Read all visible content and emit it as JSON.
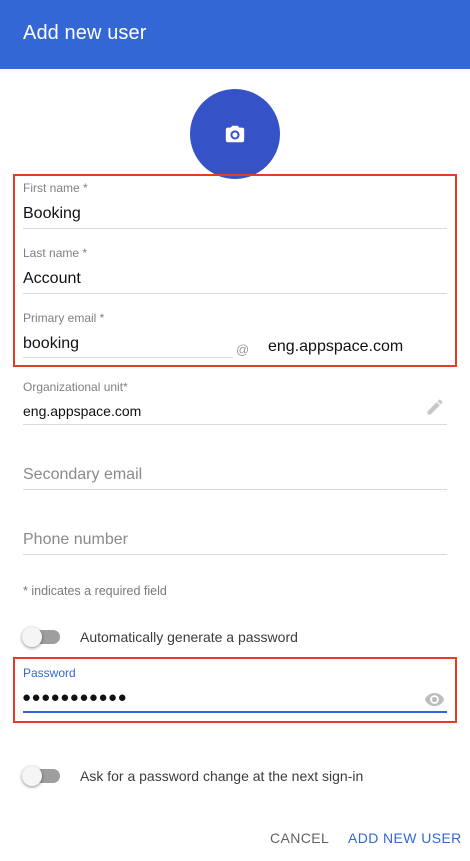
{
  "header": {
    "title": "Add new user"
  },
  "avatar": {
    "icon": "camera-icon"
  },
  "form": {
    "first_name": {
      "label": "First name *",
      "value": "Booking"
    },
    "last_name": {
      "label": "Last name *",
      "value": "Account"
    },
    "primary_email": {
      "label": "Primary email *",
      "value": "booking",
      "at": "@",
      "domain": "eng.appspace.com"
    },
    "org_unit": {
      "label": "Organizational unit*",
      "value": "eng.appspace.com",
      "icon": "pencil-icon"
    },
    "secondary_email": {
      "placeholder": "Secondary email"
    },
    "phone": {
      "placeholder": "Phone number"
    },
    "required_note": "* indicates a required field",
    "auto_password": {
      "label": "Automatically generate a password",
      "on": false
    },
    "password": {
      "label": "Password",
      "value": "●●●●●●●●●●●",
      "icon": "eye-icon"
    },
    "ask_change": {
      "label": "Ask for a password change at the next sign-in",
      "on": false
    }
  },
  "actions": {
    "cancel": "CANCEL",
    "submit": "ADD NEW USER"
  },
  "colors": {
    "header": "#3367d6",
    "accent": "#3367d6",
    "highlight": "#e53c2a"
  }
}
